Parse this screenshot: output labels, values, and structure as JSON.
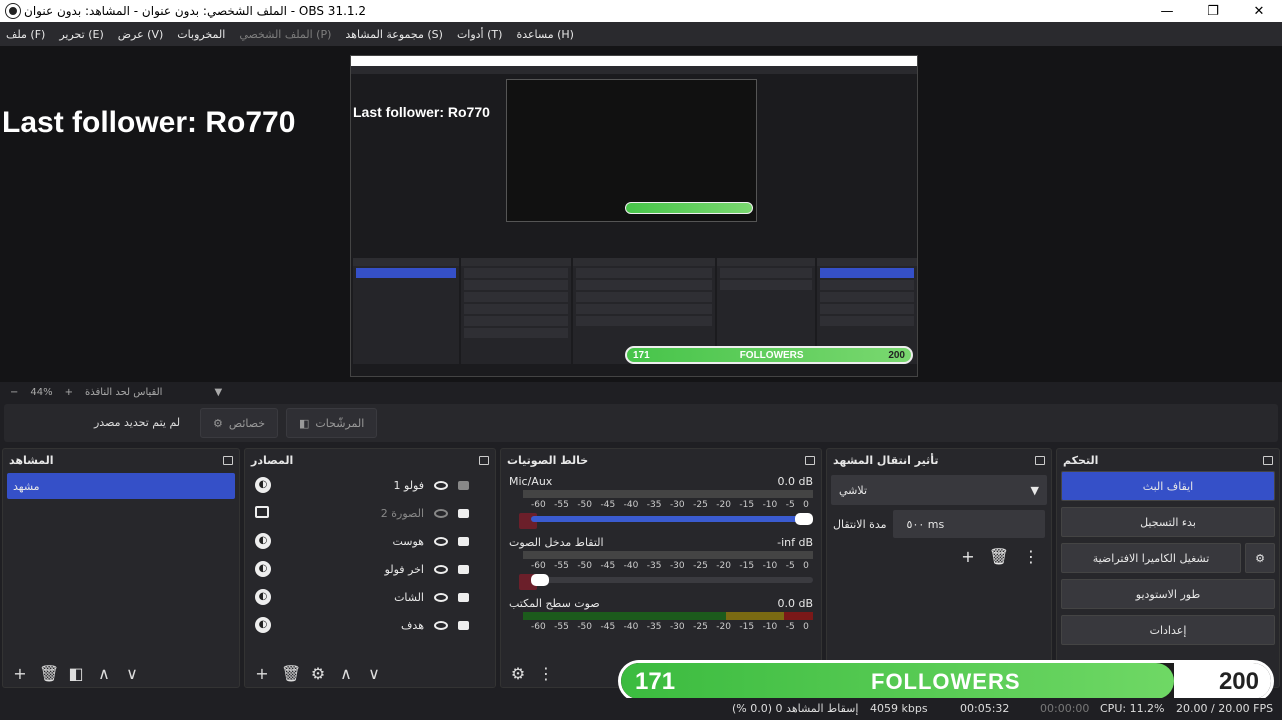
{
  "window": {
    "title": "الملف الشخصي: بدون عنوان - المشاهد: بدون عنوان - OBS 31.1.2",
    "min": "—",
    "max": "❐",
    "close": "✕"
  },
  "menu": [
    "ملف (F)",
    "تحرير (E)",
    "عرض (V)",
    "المخروبات",
    "الملف الشخصي (P)",
    "مجموعة المشاهد (S)",
    "أدوات (T)",
    "مساعدة (H)"
  ],
  "preview": {
    "last_follower": "Last follower: Ro770",
    "zoom": "44%",
    "fit_label": "القياس لحد النافذة"
  },
  "source_bar": {
    "no_source": "لم يتم تحديد مصدر",
    "properties": "خصائص",
    "filters": "المرشّحات"
  },
  "scenes": {
    "title": "المشاهد",
    "items": [
      "مشهد"
    ]
  },
  "sources": {
    "title": "المصادر",
    "items": [
      {
        "name": "فولو 1",
        "locked": true
      },
      {
        "name": "الصورة 2",
        "locked": true,
        "hidden": true
      },
      {
        "name": "هوست",
        "locked": true
      },
      {
        "name": "اخر فولو",
        "locked": true
      },
      {
        "name": "الشات",
        "locked": true
      },
      {
        "name": "هدف",
        "locked": true
      }
    ]
  },
  "mixer": {
    "title": "خالط الصوتيات",
    "channels": [
      {
        "name": "Mic/Aux",
        "db": "0.0 dB"
      },
      {
        "name": "التقاط مدخل الصوت",
        "db": "-inf dB"
      },
      {
        "name": "صوت سطح المكتب",
        "db": "0.0 dB"
      }
    ],
    "scale": [
      "-60",
      "-55",
      "-50",
      "-45",
      "-40",
      "-35",
      "-30",
      "-25",
      "-20",
      "-15",
      "-10",
      "-5",
      "0"
    ]
  },
  "transitions": {
    "title": "تأثير انتقال المشهد",
    "type": "تلاشي",
    "duration_label": "مدة الانتقال",
    "duration": "٥٠٠ ms"
  },
  "controls": {
    "title": "التحكم",
    "buttons": [
      "ايقاف البث",
      "بدء التسجيل",
      "تشغيل الكاميرا الافتراضية",
      "طور الاستوديو",
      "إعدادات"
    ]
  },
  "followers": {
    "current": "171",
    "label": "FOLLOWERS",
    "goal": "200"
  },
  "status": {
    "dropped": "إسقاط المشاهد 0 (0.0 %)",
    "bitrate": "4059 kbps",
    "stream_time": "00:05:32",
    "rec_time": "00:00:00",
    "cpu": "CPU: 11.2%",
    "fps": "20.00 / 20.00 FPS"
  }
}
